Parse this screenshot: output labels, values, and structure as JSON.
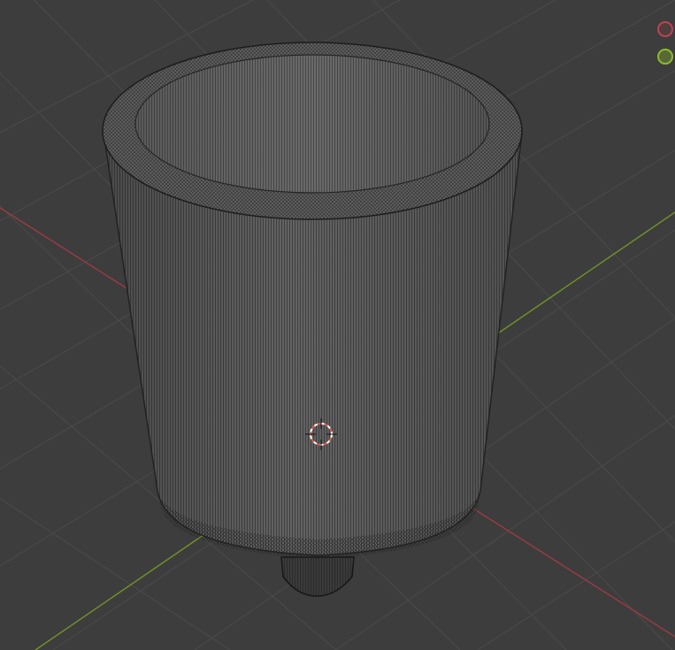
{
  "viewport": {
    "background": "#3d3d3d",
    "grid_color": "#4a4a4a",
    "x_axis_color": "#9a3a44",
    "y_axis_color": "#6f8f2a"
  },
  "mesh": {
    "display": "wireframe",
    "body_color": "#575757",
    "wire_color": "#1c1c1c"
  },
  "cursor_3d": {
    "icon": "3d-cursor-icon",
    "colors": [
      "#e05a4e",
      "#ffffff"
    ]
  },
  "nav_gizmo": {
    "x_axis_color": "#c0424e",
    "y_axis_color": "#8cbb2c"
  }
}
